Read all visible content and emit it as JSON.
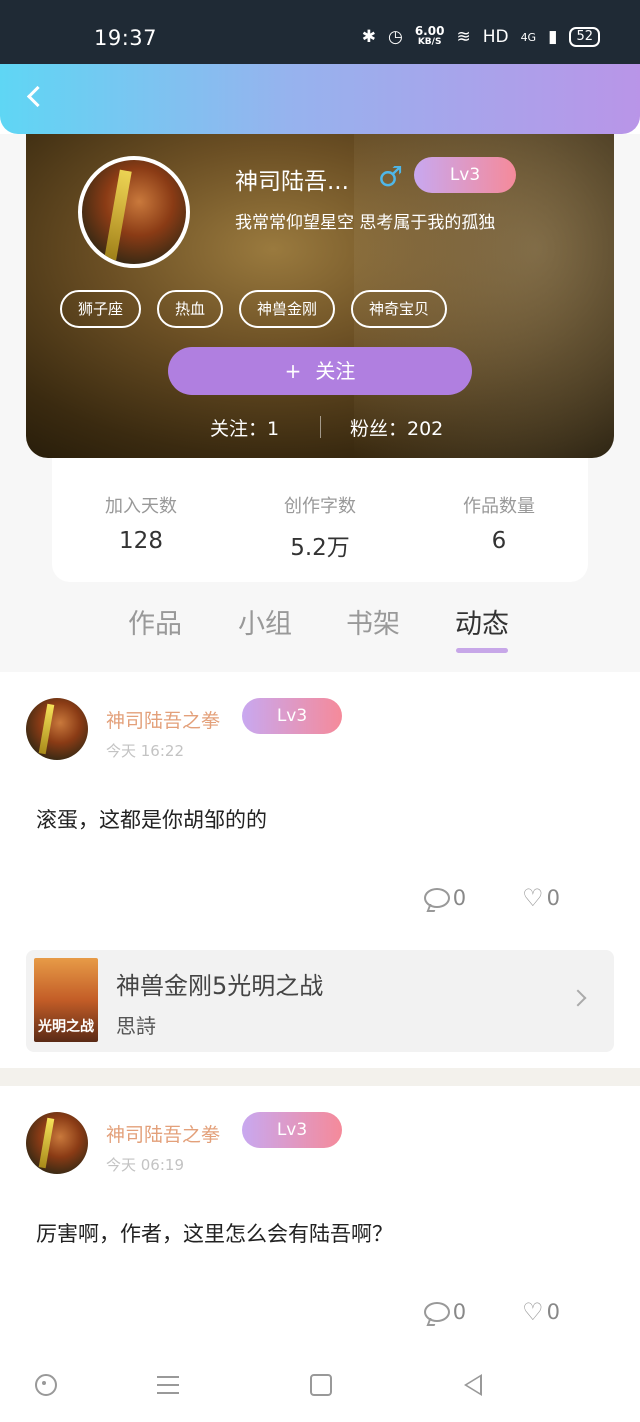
{
  "status_bar": {
    "time": "19:37",
    "network_speed_value": "6.00",
    "network_speed_unit": "KB/S",
    "hd": "HD",
    "signal_label": "4G",
    "battery": "52"
  },
  "profile": {
    "username": "神司陆吾...",
    "gender_icon": "male-symbol",
    "level": "Lv3",
    "bio": "我常常仰望星空 思考属于我的孤独",
    "tags": [
      "狮子座",
      "热血",
      "神兽金刚",
      "神奇宝贝"
    ],
    "follow_button": "关注",
    "following_label": "关注：1",
    "fans_label": "粉丝：202"
  },
  "stats": [
    {
      "label": "加入天数",
      "value": "128"
    },
    {
      "label": "创作字数",
      "value": "5.2万"
    },
    {
      "label": "作品数量",
      "value": "6"
    }
  ],
  "tabs": [
    {
      "label": "作品",
      "active": false
    },
    {
      "label": "小组",
      "active": false
    },
    {
      "label": "书架",
      "active": false
    },
    {
      "label": "动态",
      "active": true
    }
  ],
  "posts": [
    {
      "author": "神司陆吾之拳",
      "level": "Lv3",
      "time": "今天 16:22",
      "content": "滚蛋，这都是你胡邹的的",
      "comments": "0",
      "likes": "0",
      "book": {
        "title": "神兽金刚5光明之战",
        "author": "思詩",
        "cover_text": "光明之战"
      }
    },
    {
      "author": "神司陆吾之拳",
      "level": "Lv3",
      "time": "今天 06:19",
      "content": "厉害啊，作者，这里怎么会有陆吾啊？",
      "comments": "0",
      "likes": "0"
    }
  ],
  "colors": {
    "header_gradient_start": "#5fd6f4",
    "header_gradient_end": "#b995e8",
    "follow_button": "#b07fe0",
    "level_badge_start": "#c8a8f0",
    "level_badge_end": "#f58a9a",
    "author_name": "#e3a07a",
    "tab_indicator": "#c7a7e8"
  }
}
